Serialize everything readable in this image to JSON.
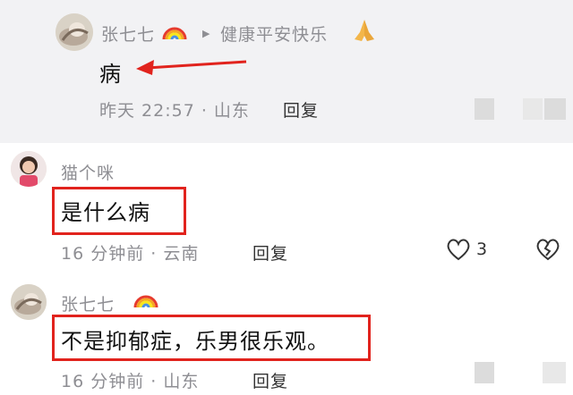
{
  "comments": [
    {
      "author": "张七七",
      "author_badge_icon": "rainbow-icon",
      "reply_arrow": "▶",
      "reply_to": "健康平安快乐",
      "reply_to_badge_icon": "praying-hands-icon",
      "text": "病",
      "meta": "昨天 22:57 · 山东",
      "reply_label": "回复"
    },
    {
      "author": "猫个咪",
      "text": "是什么病",
      "meta": "16 分钟前 · 云南",
      "reply_label": "回复",
      "like_count": "3"
    },
    {
      "author": "张七七",
      "author_badge_icon": "rainbow-icon",
      "text": "不是抑郁症，乐男很乐观。",
      "meta": "16 分钟前 · 山东",
      "reply_label": "回复"
    }
  ],
  "colors": {
    "highlight_box": "#e1231d",
    "annotation_arrow": "#e1231d",
    "meta_text": "#8e8e93",
    "top_section_bg": "#f2f2f4"
  }
}
